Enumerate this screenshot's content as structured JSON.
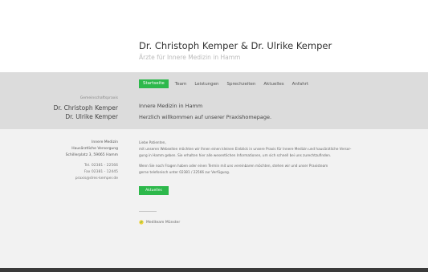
{
  "header": {
    "title": "Dr. Christoph Kemper & Dr. Ulrike Kemper",
    "subtitle": "Ärzte für Innere Medizin in Hamm"
  },
  "nav": {
    "items": [
      {
        "label": "Startseite",
        "active": true
      },
      {
        "label": "Team",
        "active": false
      },
      {
        "label": "Leistungen",
        "active": false
      },
      {
        "label": "Sprechzeiten",
        "active": false
      },
      {
        "label": "Aktuelles",
        "active": false
      },
      {
        "label": "Anfahrt",
        "active": false
      }
    ]
  },
  "practice": {
    "label": "Gemeinschaftspraxis",
    "doctor1": "Dr. Christoph Kemper",
    "doctor2": "Dr. Ulrike Kemper"
  },
  "intro": {
    "headline": "Innere Medizin in Hamm",
    "welcome": "Herzlich willkommen auf unserer Praxishomepage."
  },
  "sidebar": {
    "specialty": "Innere Medizin",
    "care": "Hausärztliche Versorgung",
    "address": "Schillerplatz 3, 59065 Hamm",
    "tel": "Tel. 02381 - 22566",
    "fax": "Fax 02381 - 12445",
    "email": "praxis@dres-kemper.de"
  },
  "main": {
    "greeting": "Liebe Patienten,",
    "line1": "mit unseren Webseiten möchten wir Ihnen einen kleinen Einblick in unsere Praxis für Innere Medizin und hausärztliche Versor-",
    "line2": "gung in Hamm geben. Sie erhalten hier alle wesentlichen Informationen, um sich schnell bei uns zurechtzufinden.",
    "line3": "Wenn Sie noch Fragen haben oder einen Termin mit uns vereinbaren möchten, stehen wir und unser Praxisteam",
    "line4": "gerne telefonisch unter 02381 / 22566 zur Verfügung.",
    "button_label": "Aktuelles",
    "mediteam_label": "Mediteam Münster"
  },
  "colors": {
    "accent": "#2db84b",
    "band": "#dcdcdc",
    "content_bg": "#f2f2f2",
    "footer": "#3a3a3a"
  }
}
